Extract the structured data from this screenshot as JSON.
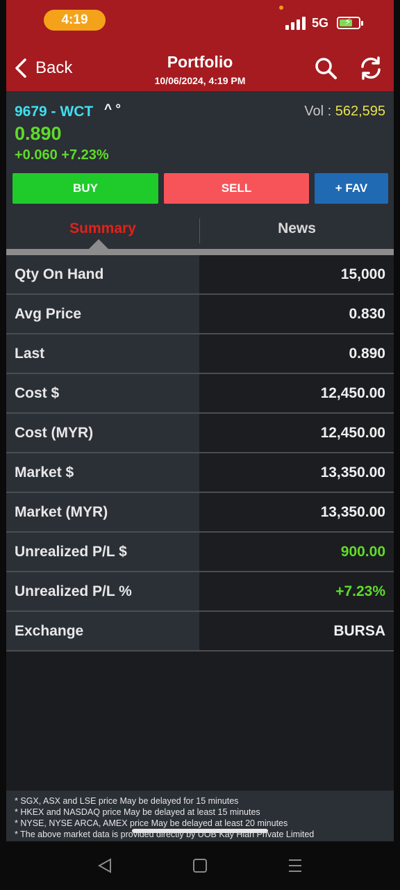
{
  "status_bar": {
    "time": "4:19",
    "network": "5G",
    "icons": [
      "signal-icon",
      "battery-charging-icon",
      "notification-dot"
    ]
  },
  "header": {
    "back_label": "Back",
    "title": "Portfolio",
    "subtitle": "10/06/2024, 4:19 PM",
    "icons": [
      "search-icon",
      "refresh-icon"
    ],
    "bg_color": "#a51b20"
  },
  "quote": {
    "symbol": "9679 - WCT",
    "symbol_marks": "^ °",
    "vol_label": "Vol :",
    "vol_value": "562,595",
    "price": "0.890",
    "change": "+0.060 +7.23%",
    "symbol_color": "#3ee0ef",
    "up_color": "#5fdb2a"
  },
  "actions": {
    "buy": "BUY",
    "sell": "SELL",
    "fav": "+ FAV",
    "colors": {
      "buy": "#1fca2b",
      "sell": "#f7545a",
      "fav": "#1f6ab3"
    }
  },
  "tabs": [
    {
      "label": "Summary",
      "active": true
    },
    {
      "label": "News",
      "active": false
    }
  ],
  "summary": [
    {
      "label": "Qty On Hand",
      "value": "15,000"
    },
    {
      "label": "Avg Price",
      "value": "0.830"
    },
    {
      "label": "Last",
      "value": "0.890"
    },
    {
      "label": "Cost $",
      "value": "12,450.00"
    },
    {
      "label": "Cost (MYR)",
      "value": "12,450.00"
    },
    {
      "label": "Market $",
      "value": "13,350.00"
    },
    {
      "label": "Market (MYR)",
      "value": "13,350.00"
    },
    {
      "label": "Unrealized P/L $",
      "value": "900.00",
      "positive": true
    },
    {
      "label": "Unrealized P/L %",
      "value": "+7.23%",
      "positive": true
    },
    {
      "label": "Exchange",
      "value": "BURSA"
    }
  ],
  "disclaimer": [
    "* SGX, ASX and LSE price May be delayed for 15 minutes",
    "* HKEX and NASDAQ price May be delayed at least 15 minutes",
    "* NYSE, NYSE ARCA, AMEX price May be delayed at least 20 minutes",
    "* The above market data is provided directly by UOB Kay Hian Private Limited"
  ],
  "system_nav": [
    "back-triangle-icon",
    "home-square-icon",
    "recents-menu-icon"
  ]
}
